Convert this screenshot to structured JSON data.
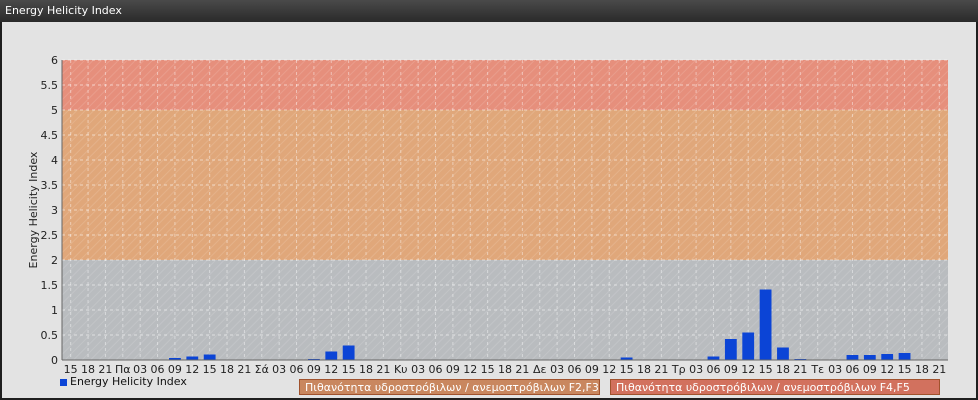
{
  "window": {
    "title": "Energy Helicity Index"
  },
  "legend": {
    "series_label": "Energy Helicity Index",
    "series_color": "#0b44d6"
  },
  "bands": [
    {
      "label": "Πιθανότητα υδροστρόβιλων / ανεμοστρόβιλων F2,F3",
      "from": 2,
      "to": 5,
      "color": "#e0a77a",
      "box_color": "#c9875f"
    },
    {
      "label": "Πιθανότητα υδροστρόβιλων / ανεμοστρόβιλων F4,F5",
      "from": 5,
      "to": 6,
      "color": "#e68f7c",
      "box_color": "#d2715e"
    }
  ],
  "chart_data": {
    "type": "bar",
    "title": "",
    "xlabel": "",
    "ylabel": "Energy Helicity Index",
    "ylim": [
      0,
      6
    ],
    "yticks": [
      0,
      0.5,
      1,
      1.5,
      2,
      2.5,
      3,
      3.5,
      4,
      4.5,
      5,
      5.5,
      6
    ],
    "grid": true,
    "categories": [
      "15",
      "18",
      "21",
      "Πα",
      "03",
      "06",
      "09",
      "12",
      "15",
      "18",
      "21",
      "Σά",
      "03",
      "06",
      "09",
      "12",
      "15",
      "18",
      "21",
      "Κυ",
      "03",
      "06",
      "09",
      "12",
      "15",
      "18",
      "21",
      "Δε",
      "03",
      "06",
      "09",
      "12",
      "15",
      "18",
      "21",
      "Τρ",
      "03",
      "06",
      "09",
      "12",
      "15",
      "18",
      "21",
      "Τε",
      "03",
      "06",
      "09",
      "12",
      "15",
      "18",
      "21"
    ],
    "series": [
      {
        "name": "Energy Helicity Index",
        "color": "#0b44d6",
        "values": [
          0.01,
          0.01,
          0.01,
          0.01,
          0.01,
          0.01,
          0.04,
          0.07,
          0.11,
          0.01,
          0.01,
          0.01,
          0.01,
          0.01,
          0.02,
          0.17,
          0.29,
          0.01,
          0.01,
          0.01,
          0.01,
          0.01,
          0.01,
          0.01,
          0.01,
          0.01,
          0.01,
          0.01,
          0.01,
          0.01,
          0.01,
          0.01,
          0.05,
          0.01,
          0.01,
          0.01,
          0.01,
          0.07,
          0.42,
          0.55,
          1.41,
          0.25,
          0.02,
          0.01,
          0.01,
          0.1,
          0.1,
          0.12,
          0.14,
          0.01,
          0.01
        ]
      }
    ]
  }
}
